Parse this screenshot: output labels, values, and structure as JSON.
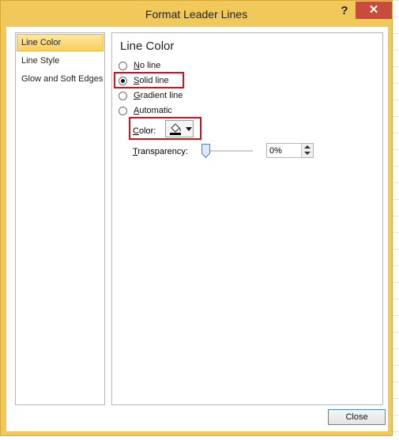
{
  "window": {
    "title": "Format Leader Lines",
    "help_label": "?",
    "close_label": "✕"
  },
  "nav": {
    "items": [
      {
        "label": "Line Color",
        "selected": true
      },
      {
        "label": "Line Style",
        "selected": false
      },
      {
        "label": "Glow and Soft Edges",
        "selected": false
      }
    ]
  },
  "panel": {
    "heading": "Line Color",
    "options": [
      {
        "label": "No line",
        "checked": false
      },
      {
        "label": "Solid line",
        "checked": true
      },
      {
        "label": "Gradient line",
        "checked": false
      },
      {
        "label": "Automatic",
        "checked": false
      }
    ],
    "color": {
      "label": "Color:",
      "value_color": "#000000",
      "icon": "paint-bucket-icon"
    },
    "transparency": {
      "label": "Transparency:",
      "value": "0%",
      "slider_level": 0
    }
  },
  "footer": {
    "close_label": "Close"
  },
  "colors": {
    "frame": "#f1c85a",
    "close": "#c74c3c",
    "highlight": "#d0121c",
    "selected_nav": "#f8cf5e"
  }
}
